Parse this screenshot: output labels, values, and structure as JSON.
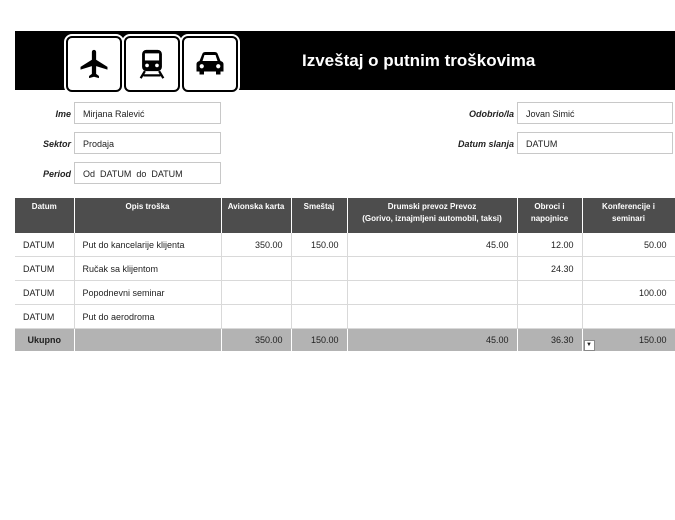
{
  "header": {
    "title": "Izveštaj o putnim troškovima",
    "icons": [
      "airplane-icon",
      "train-icon",
      "car-icon"
    ]
  },
  "form": {
    "name_label": "Ime",
    "name_value": "Mirjana Ralević",
    "sector_label": "Sektor",
    "sector_value": "Prodaja",
    "period_label": "Period",
    "period_value": "Od  DATUM  do  DATUM",
    "approved_label": "Odobrio/la",
    "approved_value": "Jovan Simić",
    "sent_label": "Datum slanja",
    "sent_value": "DATUM"
  },
  "table": {
    "headers": {
      "date": "Datum",
      "desc": "Opis troška",
      "airfare": "Avionska karta",
      "lodging": "Smeštaj",
      "ground1": "Drumski prevoz Prevoz",
      "ground2": "(Gorivo, iznajmljeni automobil, taksi)",
      "meals1": "Obroci i",
      "meals2": "napojnice",
      "conf1": "Konferencije i",
      "conf2": "seminari"
    },
    "rows": [
      {
        "date": "DATUM",
        "desc": "Put do kancelarije klijenta",
        "airfare": "350.00",
        "lodging": "150.00",
        "ground": "45.00",
        "meals": "12.00",
        "conf": "50.00"
      },
      {
        "date": "DATUM",
        "desc": "Ručak sa klijentom",
        "airfare": "",
        "lodging": "",
        "ground": "",
        "meals": "24.30",
        "conf": ""
      },
      {
        "date": "DATUM",
        "desc": "Popodnevni seminar",
        "airfare": "",
        "lodging": "",
        "ground": "",
        "meals": "",
        "conf": "100.00"
      },
      {
        "date": "DATUM",
        "desc": "Put do aerodroma",
        "airfare": "",
        "lodging": "",
        "ground": "",
        "meals": "",
        "conf": ""
      }
    ],
    "total": {
      "label": "Ukupno",
      "airfare": "350.00",
      "lodging": "150.00",
      "ground": "45.00",
      "meals": "36.30",
      "conf": "150.00"
    }
  }
}
